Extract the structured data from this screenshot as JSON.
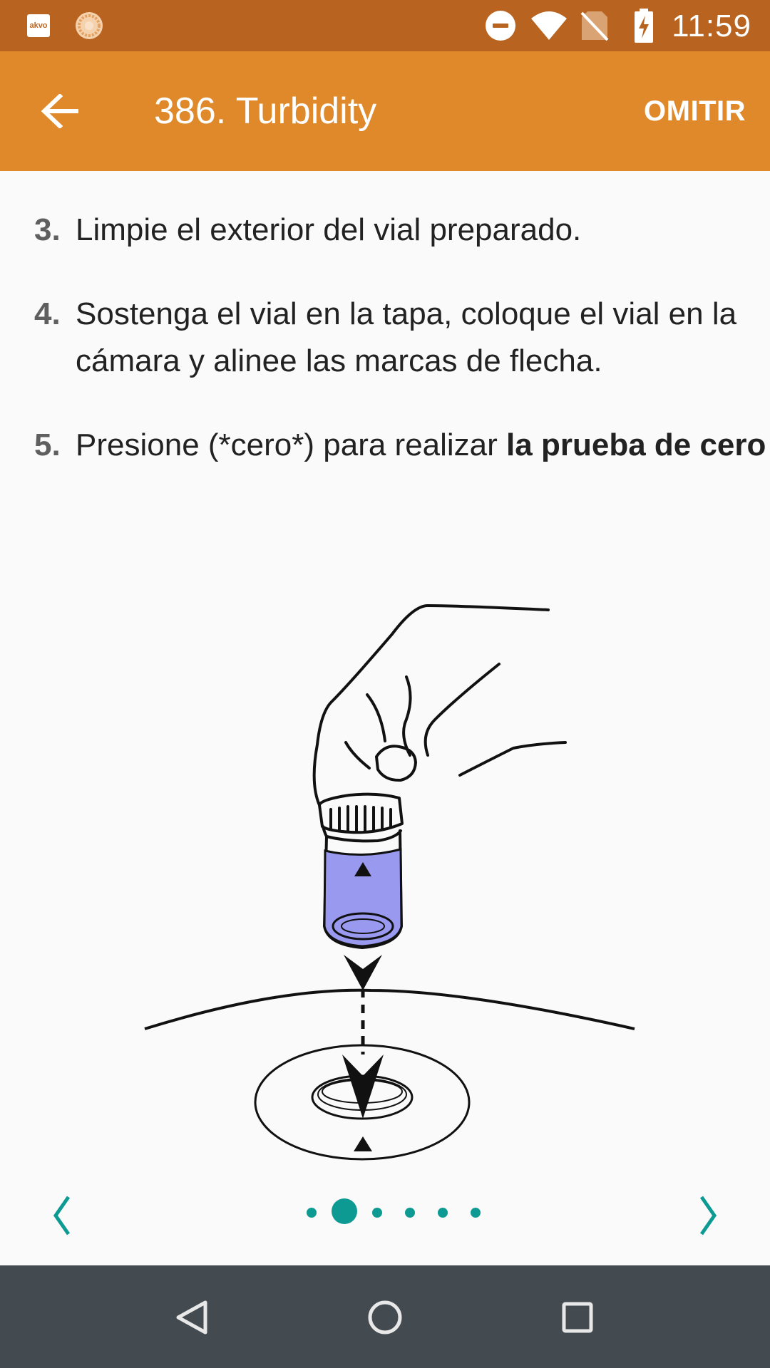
{
  "status_bar": {
    "app_icon_text": "akvo",
    "time": "11:59",
    "icons": [
      "akvo-app-icon",
      "flower-app-icon",
      "do-not-disturb-icon",
      "wifi-icon",
      "no-sim-icon",
      "battery-charging-icon"
    ]
  },
  "app_bar": {
    "title": "386. Turbidity",
    "skip_label": "OMITIR",
    "back_icon": "arrow-back-icon"
  },
  "steps": [
    {
      "number": "3.",
      "text": "Limpie el exterior del vial preparado."
    },
    {
      "number": "4.",
      "text": "Sostenga el vial en la tapa, coloque el vial en la cámara y alinee las marcas de flecha."
    },
    {
      "number": "5.",
      "text_plain": "Presione (*cero*) para realizar ",
      "text_bold": "la prueba de cero"
    }
  ],
  "pager": {
    "total_pages": 6,
    "current_page": 2,
    "prev_icon": "chevron-left-icon",
    "next_icon": "chevron-right-icon"
  },
  "colors": {
    "status_bar": "#b8631f",
    "app_bar": "#df892b",
    "accent": "#0d9a92",
    "vial_liquid": "#9999f0",
    "nav_bar": "#434a50"
  }
}
